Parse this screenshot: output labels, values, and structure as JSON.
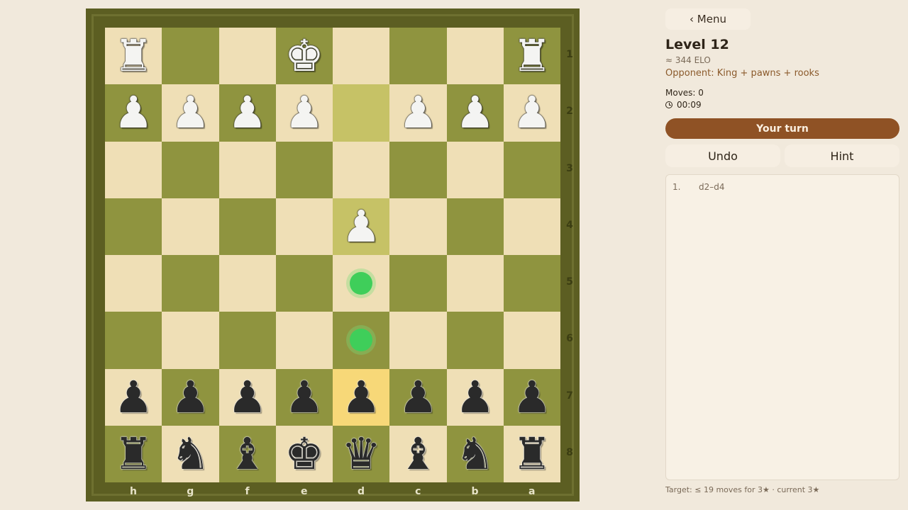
{
  "menu": {
    "label": "‹ Menu"
  },
  "level": {
    "title": "Level 12",
    "elo": "≈ 344 ELO",
    "opponent": "Opponent: King + pawns + rooks"
  },
  "status": {
    "moves": "Moves: 0",
    "timer": "00:09",
    "turn": "Your turn"
  },
  "actions": {
    "undo": "Undo",
    "hint": "Hint"
  },
  "move_list": [
    {
      "num": "1.",
      "move": "d2–d4"
    }
  ],
  "target": "Target: ≤ 19 moves for 3★ · current 3★",
  "board": {
    "files": [
      "h",
      "g",
      "f",
      "e",
      "d",
      "c",
      "b",
      "a"
    ],
    "ranks": [
      "1",
      "2",
      "3",
      "4",
      "5",
      "6",
      "7",
      "8"
    ],
    "rows": [
      [
        "wR",
        "",
        "",
        "wK",
        "",
        "",
        "",
        "wR"
      ],
      [
        "wP",
        "wP",
        "wP",
        "wP",
        "",
        "wP",
        "wP",
        "wP"
      ],
      [
        "",
        "",
        "",
        "",
        "",
        "",
        "",
        ""
      ],
      [
        "",
        "",
        "",
        "",
        "wP",
        "",
        "",
        ""
      ],
      [
        "",
        "",
        "",
        "",
        "dot",
        "",
        "",
        ""
      ],
      [
        "",
        "",
        "",
        "",
        "dot",
        "",
        "",
        ""
      ],
      [
        "bP",
        "bP",
        "bP",
        "bP",
        "bP",
        "bP",
        "bP",
        "bP"
      ],
      [
        "bR",
        "bN",
        "bB",
        "bK",
        "bQ",
        "bB",
        "bN",
        "bR"
      ]
    ],
    "highlights": [
      {
        "row": 1,
        "col": 4,
        "kind": "last-move"
      },
      {
        "row": 3,
        "col": 4,
        "kind": "last-move"
      },
      {
        "row": 6,
        "col": 4,
        "kind": "selected"
      }
    ]
  },
  "colors": {
    "light_square": "#efdfb6",
    "dark_square": "#8f943f",
    "frame": "#5c5e22",
    "accent": "#8f5225",
    "move_dot": "#3fce5a"
  }
}
